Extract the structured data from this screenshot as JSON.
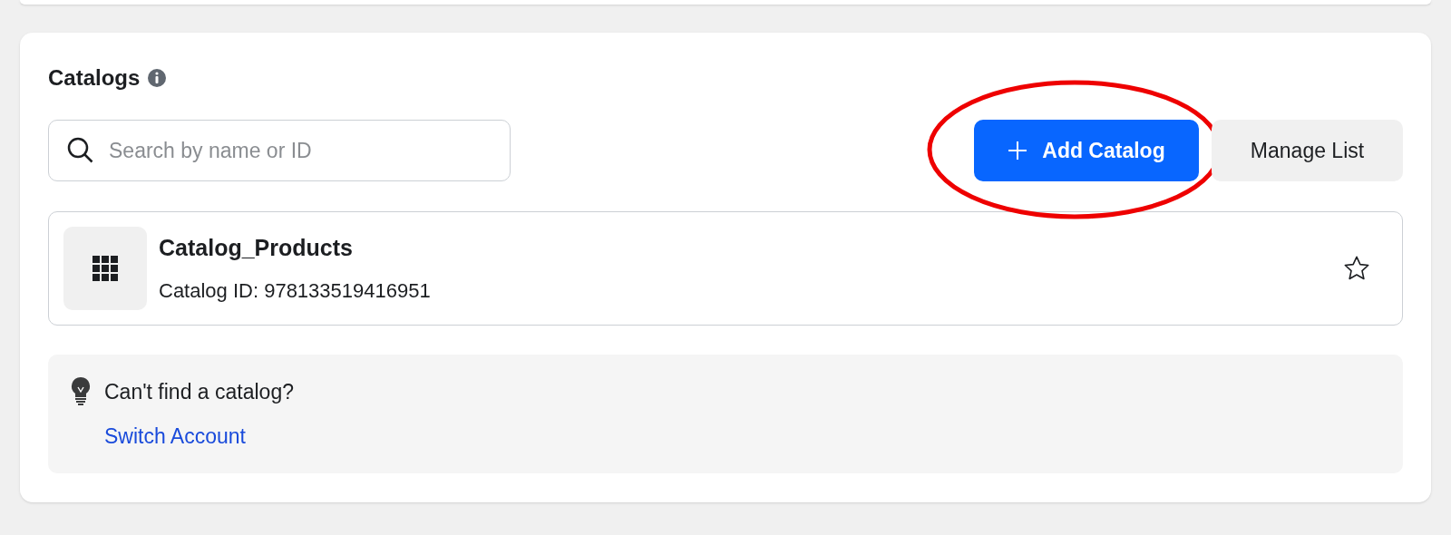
{
  "section": {
    "title": "Catalogs"
  },
  "search": {
    "placeholder": "Search by name or ID"
  },
  "buttons": [
    {
      "kind": "primary",
      "label": "Add Catalog",
      "highlighted": true
    },
    {
      "kind": "secondary",
      "label": "Manage List"
    }
  ],
  "catalogs": [
    {
      "name": "Catalog_Products",
      "id_text": "Catalog ID: 978133519416951",
      "starred": false
    }
  ],
  "tip": {
    "text": "Can't find a catalog?",
    "link": "Switch Account"
  }
}
